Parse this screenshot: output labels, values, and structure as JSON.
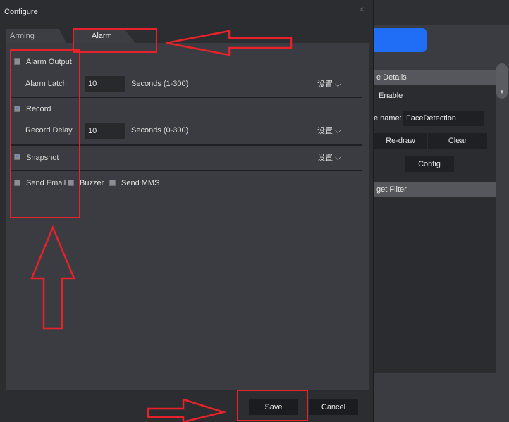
{
  "dialog": {
    "title": "Configure",
    "close_glyph": "×",
    "tabs": [
      {
        "label": "Arming schedule",
        "active": false
      },
      {
        "label": "Alarm",
        "active": true
      }
    ]
  },
  "alarm": {
    "alarm_output": {
      "label": "Alarm Output",
      "checked": false
    },
    "alarm_latch": {
      "label": "Alarm Latch",
      "value": "10",
      "unit": "Seconds (1-300)"
    },
    "record": {
      "label": "Record",
      "checked": true
    },
    "record_delay": {
      "label": "Record Delay",
      "value": "10",
      "unit": "Seconds (0-300)"
    },
    "snapshot": {
      "label": "Snapshot",
      "checked": true
    },
    "setting_label": "设置",
    "send_email": {
      "label": "Send Email",
      "checked": false
    },
    "buzzer": {
      "label": "Buzzer",
      "checked": false
    },
    "send_mms": {
      "label": "Send MMS",
      "checked": false
    }
  },
  "footer": {
    "save_label": "Save",
    "cancel_label": "Cancel"
  },
  "background": {
    "section_details": "e Details",
    "enable_label": "Enable",
    "rule_name_label": "e name:",
    "rule_name_value": "FaceDetection",
    "redraw_label": "Re-draw",
    "clear_label": "Clear",
    "config_label": "Config",
    "section_filter": "get Filter"
  },
  "colors": {
    "accent_blue": "#1f6ef5",
    "annotation_red": "#e8222a"
  }
}
